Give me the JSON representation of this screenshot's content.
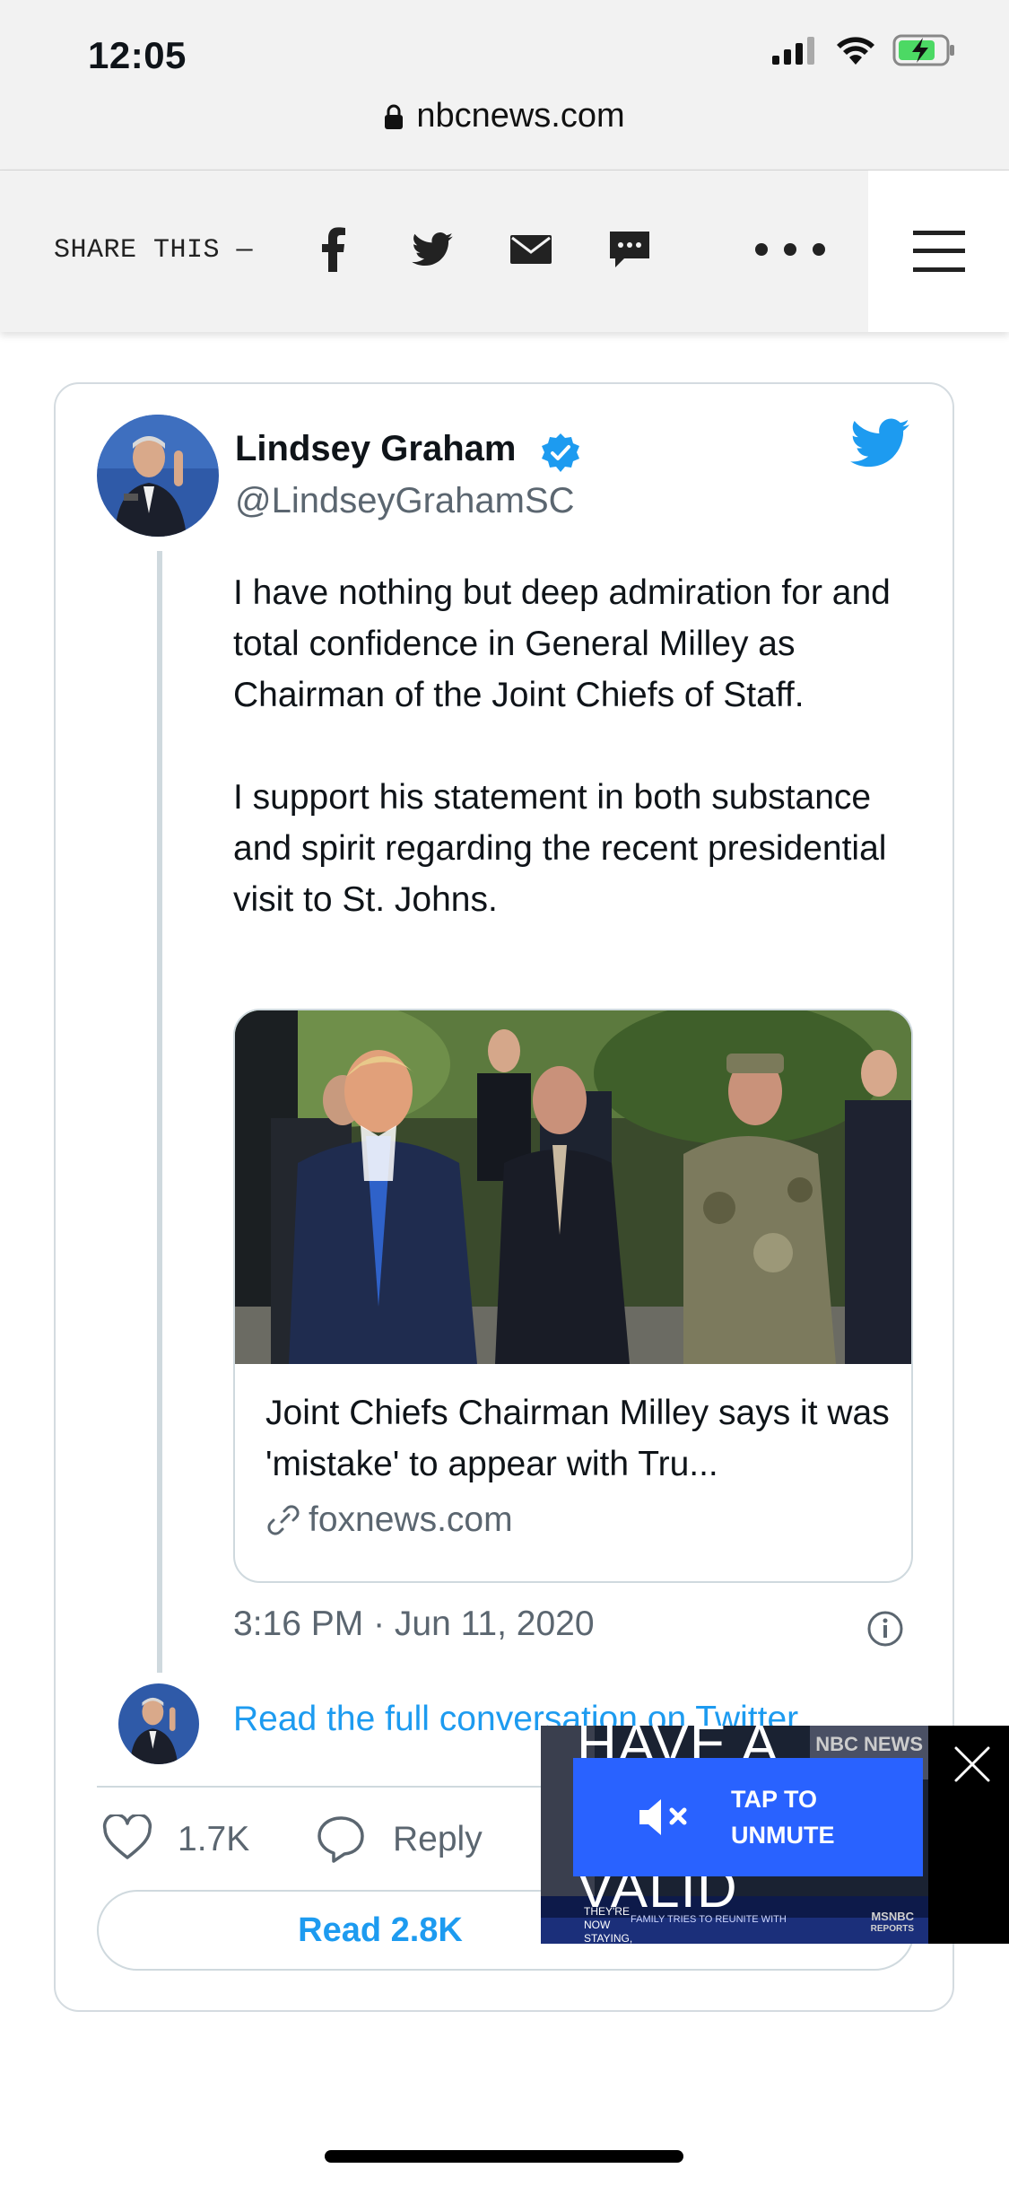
{
  "status_bar": {
    "time": "12:05"
  },
  "browser": {
    "url": "nbcnews.com"
  },
  "share_bar": {
    "label": "SHARE THIS —",
    "icons": [
      "facebook-icon",
      "twitter-icon",
      "email-icon",
      "sms-icon",
      "more-icon"
    ],
    "menu_icon": "hamburger-icon"
  },
  "tweet": {
    "author_name": "Lindsey Graham",
    "handle": "@LindseyGrahamSC",
    "verified": true,
    "text": "I have nothing but deep admiration for and total confidence in General Milley as Chairman of the Joint Chiefs of Staff.\n\nI support his statement in both substance and spirit regarding the recent presidential visit to St. Johns.",
    "link_card": {
      "title": "Joint Chiefs Chairman Milley says it was 'mistake' to appear with Tru...",
      "domain": "foxnews.com"
    },
    "timestamp": "3:16 PM · Jun 11, 2020",
    "read_conversation": "Read the full conversation on Twitter",
    "likes": "1.7K",
    "reply_label": "Reply",
    "read_replies": "Read 2.8K"
  },
  "video_overlay": {
    "headline_top": "HAVE A",
    "headline_bottom": "VALID",
    "unmute_line1": "TAP TO",
    "unmute_line2": "UNMUTE",
    "ticker_text": "THEY'RE NOW STAYING, THE BOY",
    "ticker_sub": "FAMILY TRIES TO REUNITE WITH",
    "network_tag": "NBC NEWS",
    "network_brand": "MSNBC",
    "network_brand_sub": "REPORTS"
  },
  "colors": {
    "twitter_blue": "#1d9bf0",
    "unmute_blue": "#2962ff",
    "muted_text": "#5b6670"
  }
}
